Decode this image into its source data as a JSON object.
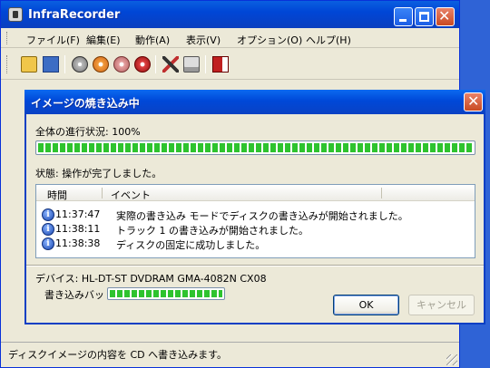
{
  "window": {
    "title": "InfraRecorder"
  },
  "menubar": {
    "items": [
      "ファイル(F)",
      "編集(E)",
      "動作(A)",
      "表示(V)",
      "オプション(O)",
      "ヘルプ(H)"
    ]
  },
  "toolbar": {
    "icons": [
      "open-icon",
      "save-icon",
      "disc-icon",
      "burn-disc-icon",
      "copy-disc-icon",
      "erase-disc-icon",
      "tools-icon",
      "drive-icon",
      "exit-icon"
    ]
  },
  "statusbar": {
    "text": "ディスクイメージの内容を CD へ書き込みます。"
  },
  "dialog": {
    "title": "イメージの焼き込み中",
    "overall_label": "全体の進行状況: 100%",
    "overall_progress": 1.0,
    "status_label": "状態: 操作が完了しました。",
    "columns": [
      "時間",
      "イベント"
    ],
    "events": [
      {
        "time": "11:37:47",
        "message": "実際の書き込み モードでディスクの書き込みが開始されました。"
      },
      {
        "time": "11:38:11",
        "message": "トラック 1 の書き込みが開始されました。"
      },
      {
        "time": "11:38:38",
        "message": "ディスクの固定に成功しました。"
      }
    ],
    "device_label": "デバイス: HL-DT-ST DVDRAM GMA-4082N CX08",
    "buffer_label": "書き込みバッ",
    "buffer_progress": 1.0,
    "ok_label": "OK",
    "cancel_label": "キャンセル"
  },
  "colors": {
    "titlebar": "#0046d6",
    "progress_fill": "#2ec32e",
    "dialog_bg": "#ece9d8"
  }
}
